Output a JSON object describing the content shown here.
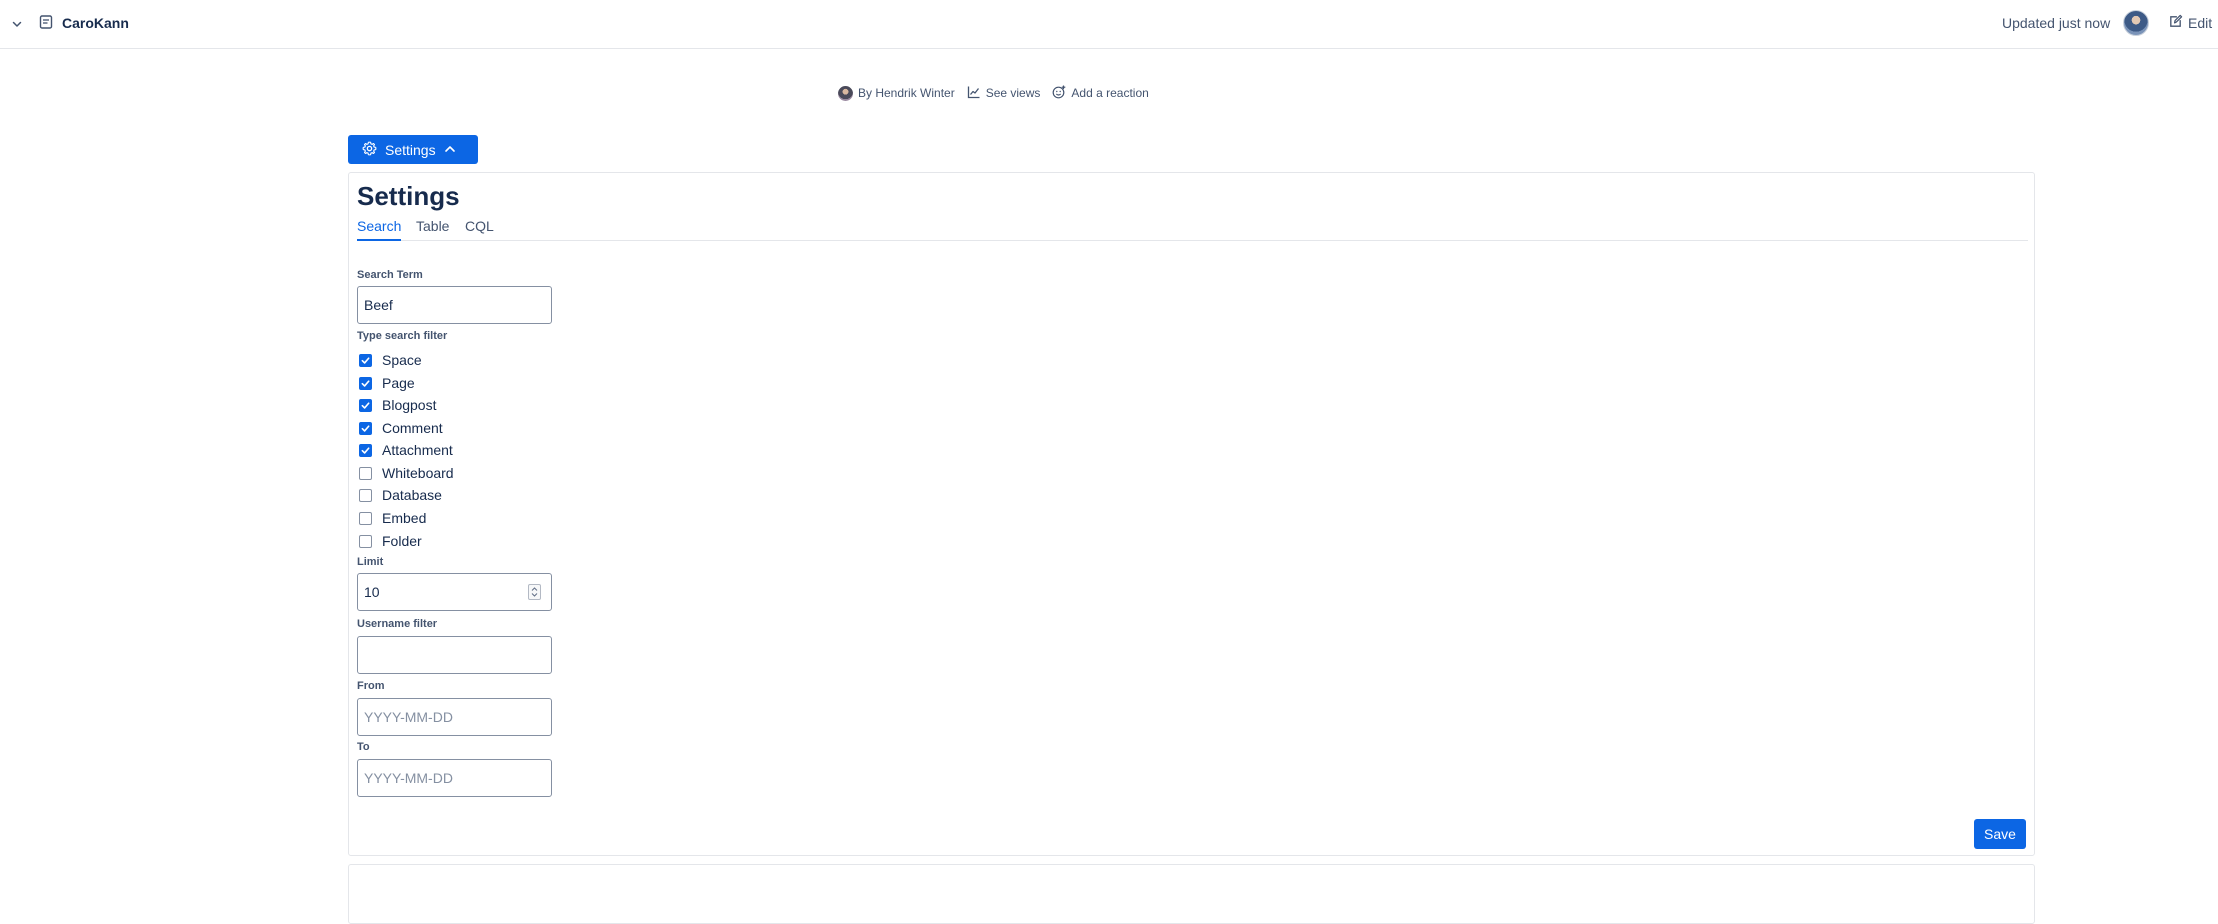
{
  "header": {
    "title": "CaroKann",
    "updated": "Updated just now",
    "edit_label": "Edit"
  },
  "byline": {
    "author": "By Hendrik Winter",
    "views": "See views",
    "reaction": "Add a reaction"
  },
  "settings_toggle": {
    "label": "Settings"
  },
  "panel": {
    "title": "Settings",
    "tabs": [
      {
        "label": "Search",
        "active": true
      },
      {
        "label": "Table",
        "active": false
      },
      {
        "label": "CQL",
        "active": false
      }
    ],
    "search_term": {
      "label": "Search Term",
      "value": "Beef"
    },
    "type_filter": {
      "label": "Type search filter",
      "options": [
        {
          "label": "Space",
          "checked": true
        },
        {
          "label": "Page",
          "checked": true
        },
        {
          "label": "Blogpost",
          "checked": true
        },
        {
          "label": "Comment",
          "checked": true
        },
        {
          "label": "Attachment",
          "checked": true
        },
        {
          "label": "Whiteboard",
          "checked": false
        },
        {
          "label": "Database",
          "checked": false
        },
        {
          "label": "Embed",
          "checked": false
        },
        {
          "label": "Folder",
          "checked": false
        }
      ]
    },
    "limit": {
      "label": "Limit",
      "value": "10"
    },
    "username": {
      "label": "Username filter",
      "value": ""
    },
    "from": {
      "label": "From",
      "placeholder": "YYYY-MM-DD"
    },
    "to": {
      "label": "To",
      "placeholder": "YYYY-MM-DD"
    },
    "save_label": "Save"
  },
  "colors": {
    "accent": "#0c66e4",
    "text": "#172b4d",
    "subtle": "#44546f",
    "border": "#e4e6ea"
  }
}
